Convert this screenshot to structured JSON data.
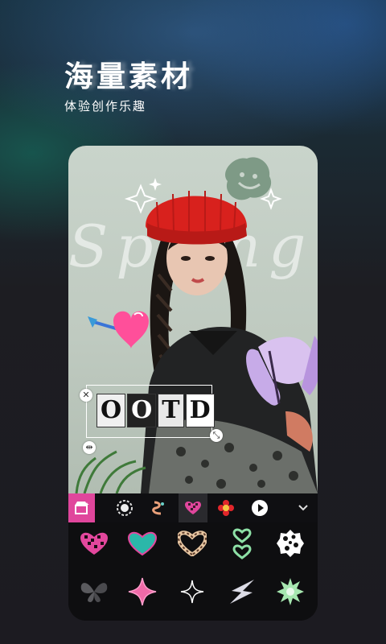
{
  "header": {
    "title": "海量素材",
    "subtitle": "体验创作乐趣"
  },
  "preview": {
    "background_word": "Spring",
    "sticker_text": [
      "O",
      "O",
      "T",
      "D"
    ]
  },
  "sticker_tabs": {
    "items": [
      {
        "icon": "sticker-store-icon",
        "active": false
      },
      {
        "icon": "lion-sticker-icon",
        "active": false
      },
      {
        "icon": "worm-sticker-icon",
        "active": false
      },
      {
        "icon": "checker-heart-sticker-icon",
        "active": true
      },
      {
        "icon": "flower-sticker-icon",
        "active": false
      },
      {
        "icon": "play-sticker-icon",
        "active": false
      }
    ],
    "expand_icon": "chevron-down-icon"
  },
  "sticker_grid": [
    "pink-checker-heart-sticker",
    "teal-heart-sticker",
    "zebra-heart-sticker",
    "green-double-heart-sticker",
    "leopard-blob-sticker",
    "glitter-butterfly-sticker",
    "pink-four-point-star-sticker",
    "outline-sparkle-sticker",
    "silver-shard-sticker",
    "green-burst-sticker"
  ],
  "colors": {
    "accent": "#e0469c",
    "beanie_red": "#d8211d",
    "panel": "#0e0e10"
  }
}
